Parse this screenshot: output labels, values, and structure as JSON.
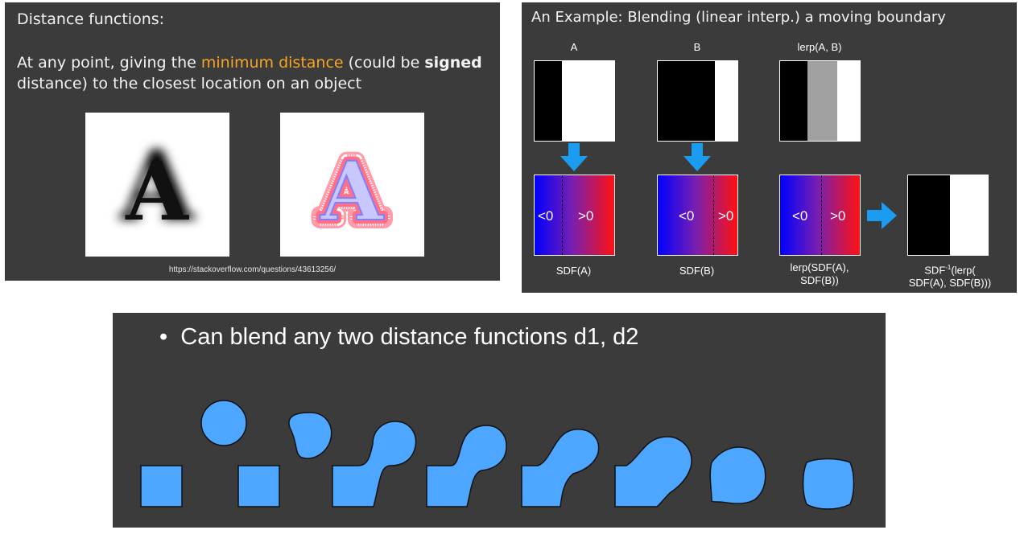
{
  "slide1": {
    "title": "Distance functions:",
    "body_prefix": "At any point, giving the ",
    "body_highlight": "minimum distance",
    "body_mid": " (could be ",
    "body_bold": "signed",
    "body_suffix": " distance) to the closest location on an object",
    "letter_left": "A",
    "letter_right": "A",
    "url": "https://stackoverflow.com/questions/43613256/"
  },
  "slide2": {
    "title": "An Example: Blending (linear interp.) a moving boundary",
    "col_labels": [
      "A",
      "B",
      "lerp(A, B)"
    ],
    "sign_neg": "<0",
    "sign_pos": ">0",
    "captions": {
      "sdf_a": "SDF(A)",
      "sdf_b": "SDF(B)",
      "lerp_line1": "lerp(SDF(A),",
      "lerp_line2": "SDF(B))",
      "inv_line1_pre": "SDF",
      "inv_sup": "-1",
      "inv_line1_post": "(lerp(",
      "inv_line2": "SDF(A), SDF(B)))"
    },
    "arrow_color": "#1a9cf0"
  },
  "slide3": {
    "bullet": "•",
    "text": "Can blend any two distance functions d1, d2",
    "shape_color": "#4da6ff"
  }
}
